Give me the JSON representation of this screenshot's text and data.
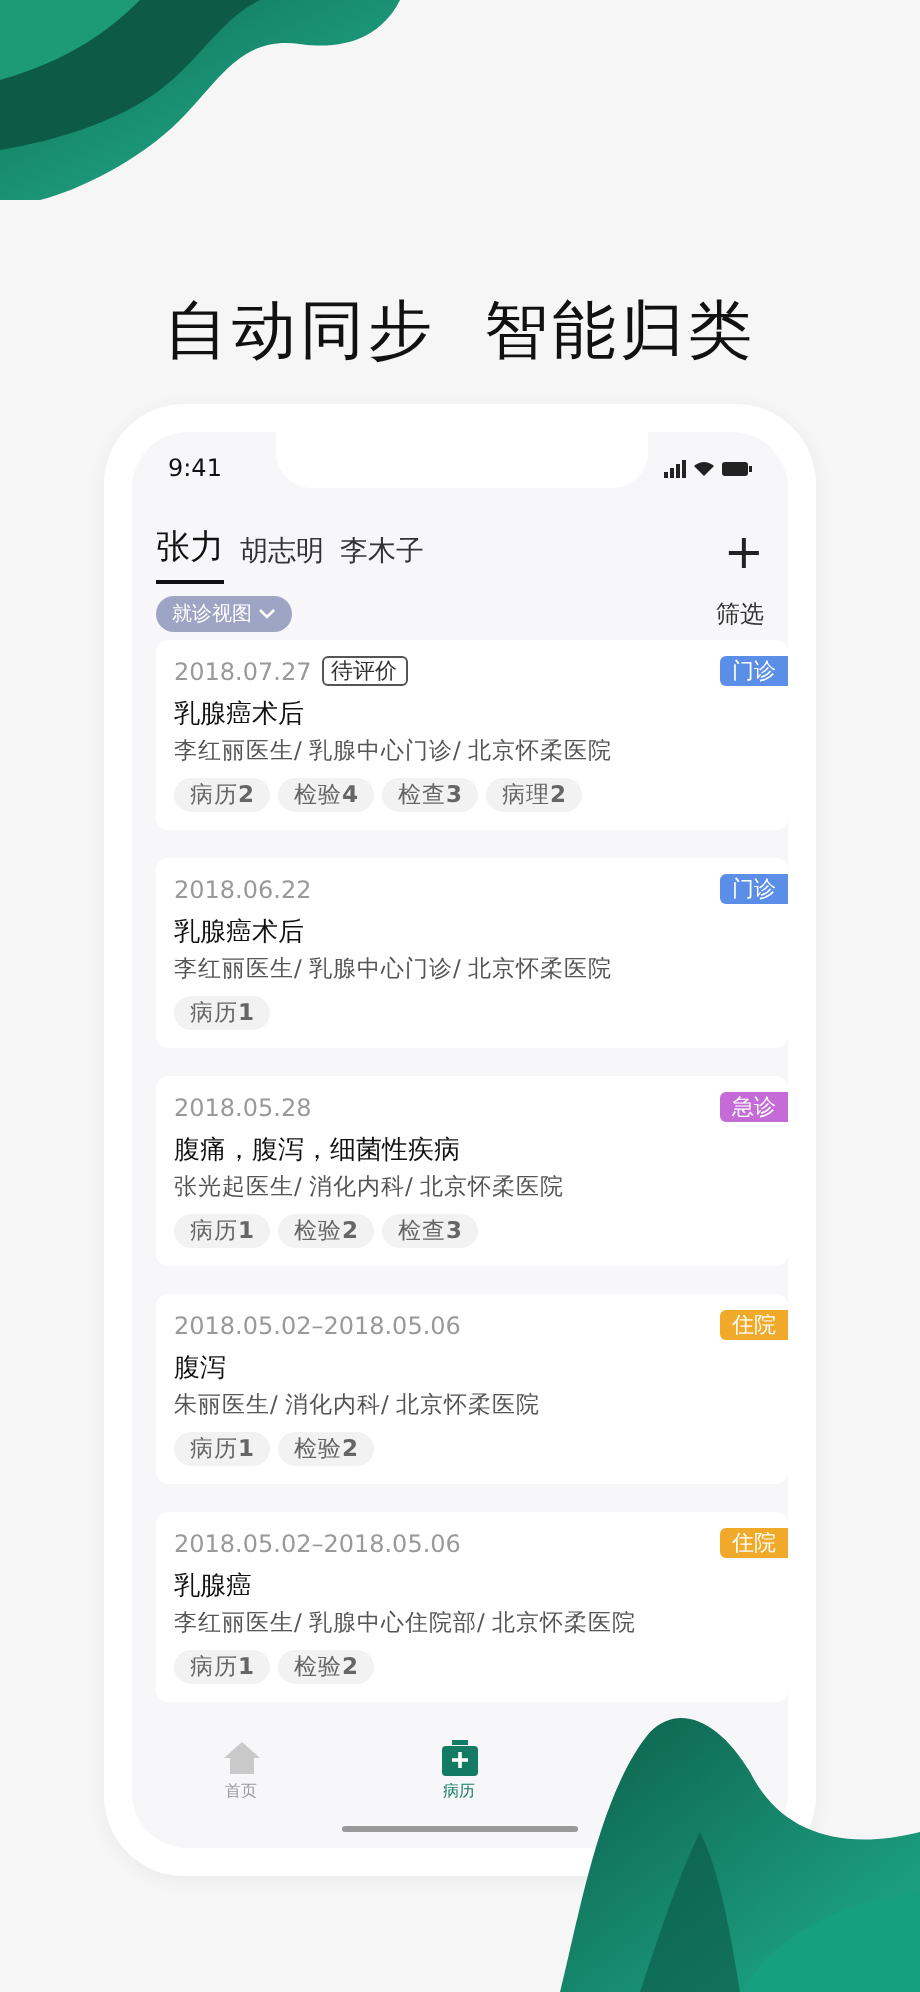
{
  "headline": "自动同步  智能归类",
  "status_bar": {
    "time": "9:41"
  },
  "tabs": [
    {
      "label": "张力",
      "selected": true
    },
    {
      "label": "胡志明",
      "selected": false
    },
    {
      "label": "李木子",
      "selected": false
    }
  ],
  "add_button": "+",
  "view_chip": "就诊视图",
  "filter": "筛选",
  "records": [
    {
      "date": "2018.07.27",
      "status": "待评价",
      "type": "门诊",
      "color": "#5b8ee6",
      "title": "乳腺癌术后",
      "source": "李红丽医生/ 乳腺中心门诊/ 北京怀柔医院",
      "tags": [
        "病历**2**",
        "检验**4**",
        "检查**3**",
        "病理**2**"
      ]
    },
    {
      "date": "2018.06.22",
      "type": "门诊",
      "color": "#5b8ee6",
      "title": "乳腺癌术后",
      "source": "李红丽医生/ 乳腺中心门诊/ 北京怀柔医院",
      "tags": [
        "病历**1**"
      ]
    },
    {
      "date": "2018.05.28",
      "type": "急诊",
      "color": "#c56bd8",
      "title": "腹痛，腹泻，细菌性疾病",
      "source": "张光起医生/ 消化内科/ 北京怀柔医院",
      "tags": [
        "病历**1**",
        "检验**2**",
        "检查**3**"
      ]
    },
    {
      "date": "2018.05.02–2018.05.06",
      "type": "住院",
      "color": "#f0a928",
      "title": "腹泻",
      "source": "朱丽医生/ 消化内科/ 北京怀柔医院",
      "tags": [
        "病历**1**",
        "检验**2**"
      ]
    },
    {
      "date": "2018.05.02–2018.05.06",
      "type": "住院",
      "color": "#f0a928",
      "title": "乳腺癌",
      "source": "李红丽医生/ 乳腺中心住院部/ 北京怀柔医院",
      "tags": [
        "病历**1**",
        "检验**2**"
      ]
    }
  ],
  "bottom_nav": [
    {
      "label": "首页",
      "kind": "home",
      "selected": false
    },
    {
      "label": "病历",
      "kind": "record",
      "selected": true
    }
  ]
}
